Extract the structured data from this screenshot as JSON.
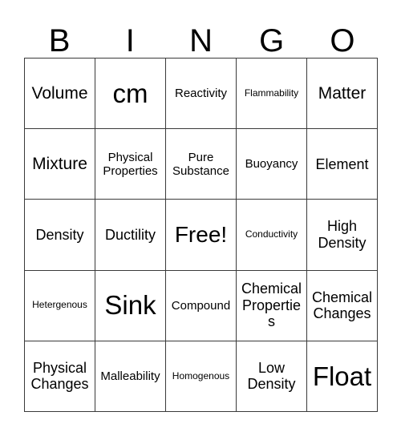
{
  "card": {
    "header_letters": [
      "B",
      "I",
      "N",
      "G",
      "O"
    ],
    "rows": [
      [
        {
          "label": "Volume",
          "size": "l"
        },
        {
          "label": "cm",
          "size": "xxl"
        },
        {
          "label": "Reactivity",
          "size": "s"
        },
        {
          "label": "Flammability",
          "size": "xs"
        },
        {
          "label": "Matter",
          "size": "l"
        }
      ],
      [
        {
          "label": "Mixture",
          "size": "l"
        },
        {
          "label": "Physical Properties",
          "size": "s"
        },
        {
          "label": "Pure Substance",
          "size": "s"
        },
        {
          "label": "Buoyancy",
          "size": "s"
        },
        {
          "label": "Element",
          "size": "m"
        }
      ],
      [
        {
          "label": "Density",
          "size": "m"
        },
        {
          "label": "Ductility",
          "size": "m"
        },
        {
          "label": "Free!",
          "size": "xl"
        },
        {
          "label": "Conductivity",
          "size": "xs"
        },
        {
          "label": "High Density",
          "size": "m"
        }
      ],
      [
        {
          "label": "Hetergenous",
          "size": "xs"
        },
        {
          "label": "Sink",
          "size": "xxl"
        },
        {
          "label": "Compound",
          "size": "s"
        },
        {
          "label": "Chemical Properties",
          "size": "m"
        },
        {
          "label": "Chemical Changes",
          "size": "m"
        }
      ],
      [
        {
          "label": "Physical Changes",
          "size": "m"
        },
        {
          "label": "Malleability",
          "size": "s"
        },
        {
          "label": "Homogenous",
          "size": "xs"
        },
        {
          "label": "Low Density",
          "size": "m"
        },
        {
          "label": "Float",
          "size": "xxl"
        }
      ]
    ],
    "colors": {
      "background": "#ffffff",
      "text": "#000000",
      "grid_line": "#3a3a3a"
    }
  }
}
